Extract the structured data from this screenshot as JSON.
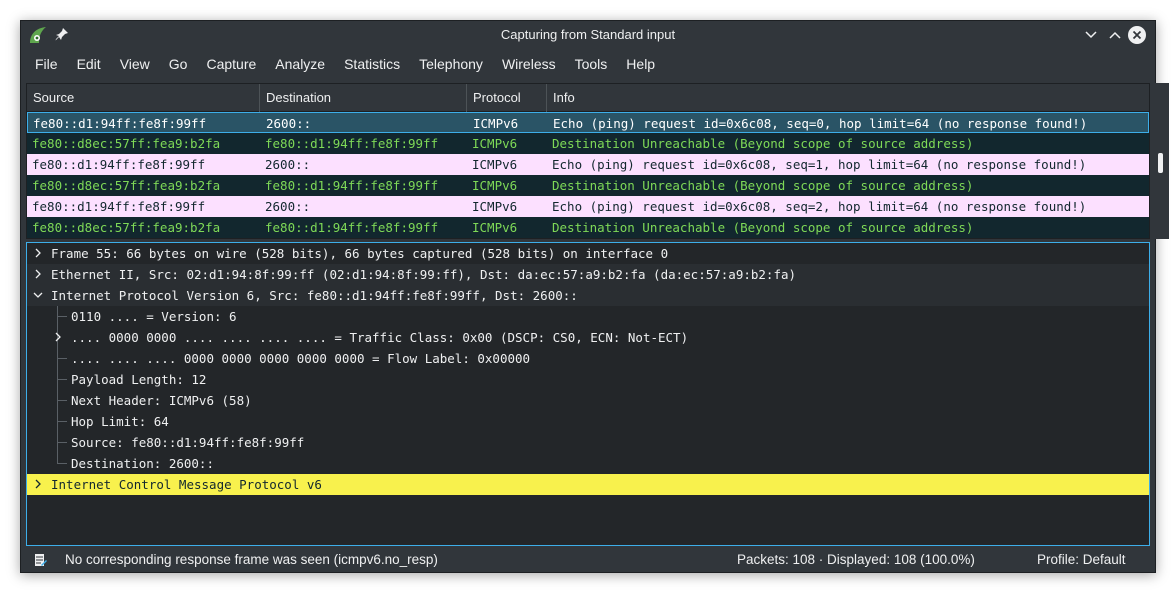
{
  "window": {
    "title": "Capturing from Standard input"
  },
  "menu": [
    "File",
    "Edit",
    "View",
    "Go",
    "Capture",
    "Analyze",
    "Statistics",
    "Telephony",
    "Wireless",
    "Tools",
    "Help"
  ],
  "packet_list": {
    "columns": [
      "Source",
      "Destination",
      "Protocol",
      "Info"
    ],
    "rows": [
      {
        "source": "fe80::d1:94ff:fe8f:99ff",
        "destination": "2600::",
        "protocol": "ICMPv6",
        "info": "Echo (ping) request id=0x6c08, seq=0, hop limit=64 (no response found!)",
        "kind": "selected"
      },
      {
        "source": "fe80::d8ec:57ff:fea9:b2fa",
        "destination": "fe80::d1:94ff:fe8f:99ff",
        "protocol": "ICMPv6",
        "info": "Destination Unreachable (Beyond scope of source address)",
        "kind": "unreach"
      },
      {
        "source": "fe80::d1:94ff:fe8f:99ff",
        "destination": "2600::",
        "protocol": "ICMPv6",
        "info": "Echo (ping) request id=0x6c08, seq=1, hop limit=64 (no response found!)",
        "kind": "echo"
      },
      {
        "source": "fe80::d8ec:57ff:fea9:b2fa",
        "destination": "fe80::d1:94ff:fe8f:99ff",
        "protocol": "ICMPv6",
        "info": "Destination Unreachable (Beyond scope of source address)",
        "kind": "unreach"
      },
      {
        "source": "fe80::d1:94ff:fe8f:99ff",
        "destination": "2600::",
        "protocol": "ICMPv6",
        "info": "Echo (ping) request id=0x6c08, seq=2, hop limit=64 (no response found!)",
        "kind": "echo"
      },
      {
        "source": "fe80::d8ec:57ff:fea9:b2fa",
        "destination": "fe80::d1:94ff:fe8f:99ff",
        "protocol": "ICMPv6",
        "info": "Destination Unreachable (Beyond scope of source address)",
        "kind": "unreach"
      }
    ]
  },
  "details": {
    "frame": "Frame 55: 66 bytes on wire (528 bits), 66 bytes captured (528 bits) on interface 0",
    "ethernet": "Ethernet II, Src: 02:d1:94:8f:99:ff (02:d1:94:8f:99:ff), Dst: da:ec:57:a9:b2:fa (da:ec:57:a9:b2:fa)",
    "ipv6": "Internet Protocol Version 6, Src: fe80::d1:94ff:fe8f:99ff, Dst: 2600::",
    "ipv6_fields": {
      "version": "0110 .... = Version: 6",
      "traffic_class": ".... 0000 0000 .... .... .... .... = Traffic Class: 0x00 (DSCP: CS0, ECN: Not-ECT)",
      "flow_label": ".... .... .... 0000 0000 0000 0000 0000 = Flow Label: 0x00000",
      "payload_length": "Payload Length: 12",
      "next_header": "Next Header: ICMPv6 (58)",
      "hop_limit": "Hop Limit: 64",
      "source": "Source: fe80::d1:94ff:fe8f:99ff",
      "destination": "Destination: 2600::"
    },
    "icmpv6": "Internet Control Message Protocol v6"
  },
  "status": {
    "message": "No corresponding response frame was seen (icmpv6.no_resp)",
    "packets": "Packets: 108 · Displayed: 108 (100.0%)",
    "profile": "Profile: Default"
  },
  "colors": {
    "accent": "#3daee9",
    "highlight": "#f8f14d",
    "echo_row": "#fce0ff",
    "unreach_row": "#12272e",
    "unreach_text": "#7ed957"
  },
  "icons": {
    "app": "wireshark-fin-icon",
    "pin": "pin-icon",
    "minimize": "chevron-down-icon",
    "maximize": "chevron-up-icon",
    "close": "close-icon",
    "status": "expert-info-icon"
  }
}
